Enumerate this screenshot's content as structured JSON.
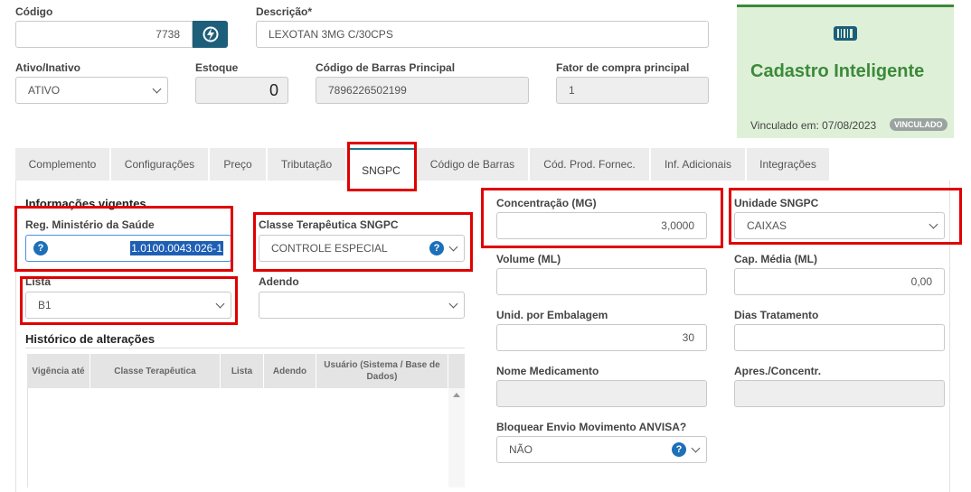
{
  "top": {
    "codigo_label": "Código",
    "codigo_value": "7738",
    "descricao_label": "Descrição*",
    "descricao_value": "LEXOTAN 3MG C/30CPS",
    "ativo_label": "Ativo/Inativo",
    "ativo_value": "ATIVO",
    "estoque_label": "Estoque",
    "estoque_value": "0",
    "barras_label": "Código de Barras Principal",
    "barras_value": "7896226502199",
    "fator_label": "Fator de compra principal",
    "fator_value": "1"
  },
  "card": {
    "title": "Cadastro Inteligente",
    "linked_text": "Vinculado em: 07/08/2023",
    "badge": "VINCULADO",
    "accent": "#3c8a3a",
    "bg": "#dff0d8"
  },
  "tabs": [
    {
      "label": "Complemento"
    },
    {
      "label": "Configurações"
    },
    {
      "label": "Preço"
    },
    {
      "label": "Tributação"
    },
    {
      "label": "SNGPC"
    },
    {
      "label": "Código de Barras"
    },
    {
      "label": "Cód. Prod. Fornec."
    },
    {
      "label": "Inf. Adicionais"
    },
    {
      "label": "Integrações"
    }
  ],
  "sngpc": {
    "section_title": "Informações vigentes",
    "reg_label": "Reg. Ministério da Saúde",
    "reg_value": "1.0100.0043.026-1",
    "classe_label": "Classe Terapêutica SNGPC",
    "classe_value": "CONTROLE ESPECIAL",
    "lista_label": "Lista",
    "lista_value": "B1",
    "adendo_label": "Adendo",
    "adendo_value": "",
    "historico_title": "Histórico de alterações",
    "table_headers": [
      "Vigência até",
      "Classe Terapêutica",
      "Lista",
      "Adendo",
      "Usuário (Sistema / Base de Dados)"
    ],
    "concentracao_label": "Concentração (MG)",
    "concentracao_value": "3,0000",
    "unidade_label": "Unidade SNGPC",
    "unidade_value": "CAIXAS",
    "volume_label": "Volume (ML)",
    "volume_value": "",
    "cap_label": "Cap. Média (ML)",
    "cap_value": "0,00",
    "unid_emb_label": "Unid. por Embalagem",
    "unid_emb_value": "30",
    "dias_label": "Dias Tratamento",
    "dias_value": "",
    "nome_label": "Nome Medicamento",
    "nome_value": "",
    "apres_label": "Apres./Concentr.",
    "apres_value": "",
    "bloquear_label": "Bloquear Envio Movimento ANVISA?",
    "bloquear_value": "NÃO"
  },
  "icons": {
    "help_glyph": "?"
  }
}
